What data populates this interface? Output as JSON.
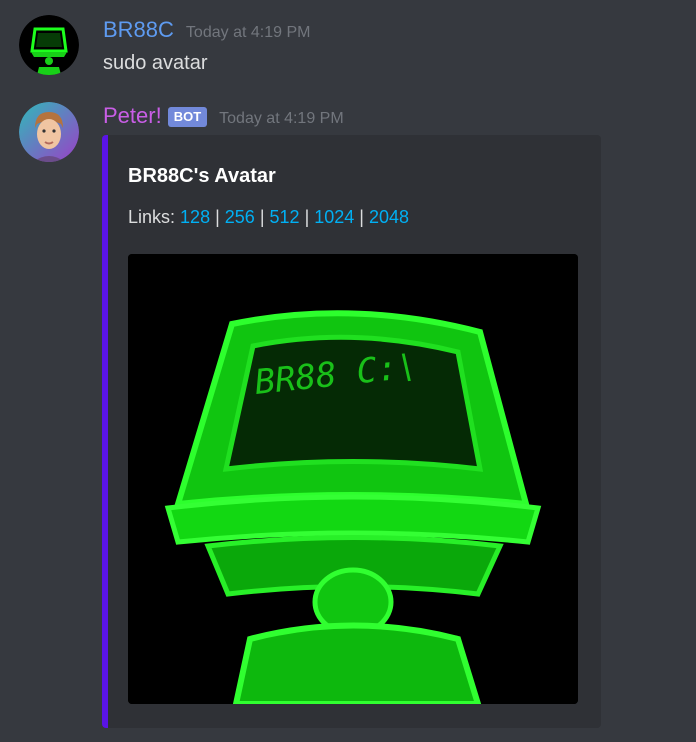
{
  "messages": [
    {
      "author": "BR88C",
      "timestamp": "Today at 4:19 PM",
      "content": "sudo avatar",
      "author_color": "#5e9bf1"
    },
    {
      "author": "Peter!",
      "bot_tag": "BOT",
      "timestamp": "Today at 4:19 PM",
      "author_color": "#c95ee6",
      "embed": {
        "accent_color": "#5a14e6",
        "title": "BR88C's Avatar",
        "links_prefix": "Links:",
        "links": [
          "128",
          "256",
          "512",
          "1024",
          "2048"
        ],
        "separator": "|",
        "image_text": "BR88 C:\\",
        "image_icon": "green-computer-terminal-icon"
      }
    }
  ]
}
